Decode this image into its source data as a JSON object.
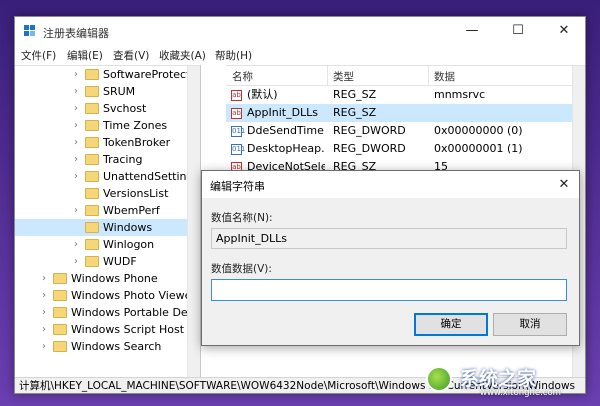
{
  "window": {
    "title": "注册表编辑器",
    "controls": {
      "minimize": "—",
      "maximize": "☐",
      "close": "✕"
    }
  },
  "menubar": {
    "items": [
      {
        "label": "文件(F)"
      },
      {
        "label": "编辑(E)"
      },
      {
        "label": "查看(V)"
      },
      {
        "label": "收藏夹(A)"
      },
      {
        "label": "帮助(H)"
      }
    ]
  },
  "tree": {
    "items": [
      {
        "label": "SoftwareProtectionPla",
        "expander": "›"
      },
      {
        "label": "SRUM",
        "expander": "›"
      },
      {
        "label": "Svchost",
        "expander": "›"
      },
      {
        "label": "Time Zones",
        "expander": "›"
      },
      {
        "label": "TokenBroker",
        "expander": "›"
      },
      {
        "label": "Tracing",
        "expander": "›"
      },
      {
        "label": "UnattendSettings",
        "expander": "›"
      },
      {
        "label": "VersionsList",
        "expander": ""
      },
      {
        "label": "WbemPerf",
        "expander": "›"
      },
      {
        "label": "Windows",
        "expander": "",
        "selected": true
      },
      {
        "label": "Winlogon",
        "expander": "›"
      },
      {
        "label": "WUDF",
        "expander": "›"
      },
      {
        "label": "Windows Phone",
        "expander": "›"
      },
      {
        "label": "Windows Photo Viewer",
        "expander": "›"
      },
      {
        "label": "Windows Portable Devices",
        "expander": "›"
      },
      {
        "label": "Windows Script Host",
        "expander": "›"
      },
      {
        "label": "Windows Search",
        "expander": "›"
      }
    ]
  },
  "values_list": {
    "headers": {
      "name": "名称",
      "type": "类型",
      "data": "数据"
    },
    "rows": [
      {
        "icon": "ab",
        "name": "(默认)",
        "type": "REG_SZ",
        "data": "mnmsrvc"
      },
      {
        "icon": "ab",
        "name": "AppInit_DLLs",
        "type": "REG_SZ",
        "data": "",
        "selected": true
      },
      {
        "icon": "011",
        "name": "DdeSendTime...",
        "type": "REG_DWORD",
        "data": "0x00000000 (0)"
      },
      {
        "icon": "011",
        "name": "DesktopHeap...",
        "type": "REG_DWORD",
        "data": "0x00000001 (1)"
      },
      {
        "icon": "ab",
        "name": "DeviceNotSele...",
        "type": "REG_SZ",
        "data": "15"
      }
    ]
  },
  "statusbar": {
    "path": "计算机\\HKEY_LOCAL_MACHINE\\SOFTWARE\\WOW6432Node\\Microsoft\\Windows NT\\CurrentVersion\\Windows"
  },
  "dialog": {
    "title": "编辑字符串",
    "close": "✕",
    "name_label": "数值名称(N):",
    "name_value": "AppInit_DLLs",
    "data_label": "数值数据(V):",
    "data_value": "",
    "ok_label": "确定",
    "cancel_label": "取消"
  },
  "watermark": {
    "text": "系统之家",
    "url": "www.xitonghe.com"
  },
  "colors": {
    "selection": "#cce8ff",
    "accent": "#0078d7",
    "folder": "#f5d77a"
  }
}
